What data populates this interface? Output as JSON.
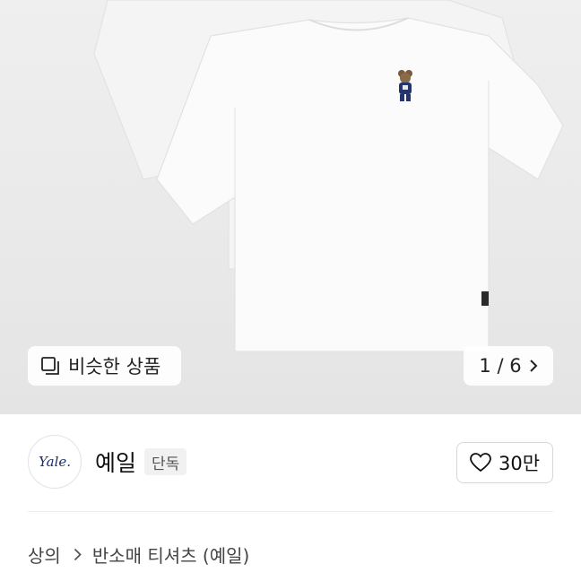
{
  "gallery": {
    "similar_label": "비슷한 상품",
    "counter": "1 / 6"
  },
  "brand": {
    "logo_text": "Yale.",
    "name": "예일",
    "exclusive_badge": "단독",
    "likes": "30만"
  },
  "breadcrumb": {
    "category": "상의",
    "subcategory": "반소매 티셔츠 (예일)"
  }
}
